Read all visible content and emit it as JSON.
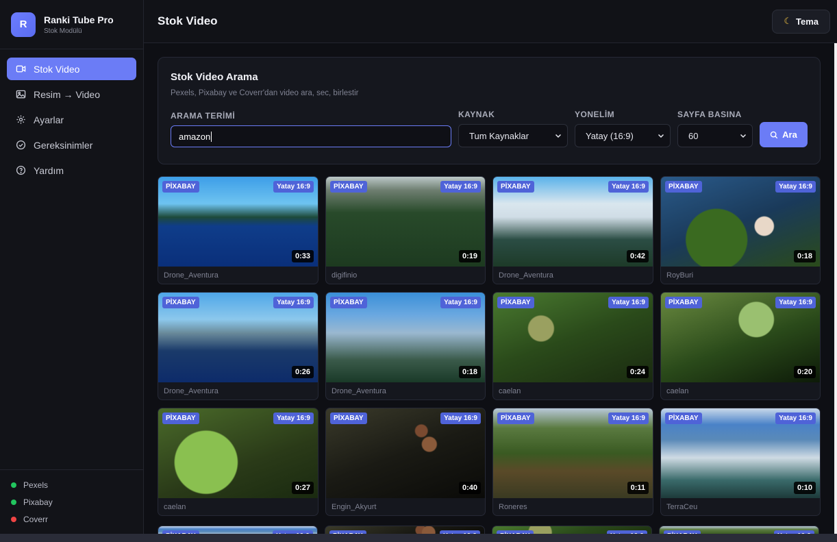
{
  "brand": {
    "logo_letter": "R",
    "title": "Ranki Tube Pro",
    "subtitle": "Stok Modülü"
  },
  "nav": [
    {
      "label": "Stok Video",
      "icon": "video-icon",
      "active": true
    },
    {
      "label": "Resim → Video",
      "icon": "image-icon",
      "active": false
    },
    {
      "label": "Ayarlar",
      "icon": "gear-icon",
      "active": false
    },
    {
      "label": "Gereksinimler",
      "icon": "check-circle-icon",
      "active": false
    },
    {
      "label": "Yardım",
      "icon": "help-icon",
      "active": false
    }
  ],
  "status": [
    {
      "label": "Pexels",
      "color": "#22c55e"
    },
    {
      "label": "Pixabay",
      "color": "#22c55e"
    },
    {
      "label": "Coverr",
      "color": "#ef4444"
    }
  ],
  "header": {
    "title": "Stok Video",
    "theme_label": "Tema",
    "theme_icon": "moon-icon"
  },
  "search": {
    "title": "Stok Video Arama",
    "subtitle": "Pexels, Pixabay ve Coverr'dan video ara, sec, birlestir",
    "term_label": "ARAMA TERİMİ",
    "term_value": "amazon",
    "source_label": "KAYNAK",
    "source_value": "Tum Kaynaklar",
    "orientation_label": "YONELİM",
    "orientation_value": "Yatay (16:9)",
    "per_page_label": "SAYFA BASINA",
    "per_page_value": "60",
    "button_label": "Ara"
  },
  "videos": [
    {
      "source": "PİXABAY",
      "orientation": "Yatay 16:9",
      "duration": "0:33",
      "author": "Drone_Aventura",
      "thumb": "t-lake1"
    },
    {
      "source": "PİXABAY",
      "orientation": "Yatay 16:9",
      "duration": "0:19",
      "author": "digifinio",
      "thumb": "t-forest1"
    },
    {
      "source": "PİXABAY",
      "orientation": "Yatay 16:9",
      "duration": "0:42",
      "author": "Drone_Aventura",
      "thumb": "t-cloud1"
    },
    {
      "source": "PİXABAY",
      "orientation": "Yatay 16:9",
      "duration": "0:18",
      "author": "RoyBuri",
      "thumb": "t-fish"
    },
    {
      "source": "PİXABAY",
      "orientation": "Yatay 16:9",
      "duration": "0:26",
      "author": "Drone_Aventura",
      "thumb": "t-lake2"
    },
    {
      "source": "PİXABAY",
      "orientation": "Yatay 16:9",
      "duration": "0:18",
      "author": "Drone_Aventura",
      "thumb": "t-mist"
    },
    {
      "source": "PİXABAY",
      "orientation": "Yatay 16:9",
      "duration": "0:24",
      "author": "caelan",
      "thumb": "t-jungle1"
    },
    {
      "source": "PİXABAY",
      "orientation": "Yatay 16:9",
      "duration": "0:20",
      "author": "caelan",
      "thumb": "t-fern"
    },
    {
      "source": "PİXABAY",
      "orientation": "Yatay 16:9",
      "duration": "0:27",
      "author": "caelan",
      "thumb": "t-leaf"
    },
    {
      "source": "PİXABAY",
      "orientation": "Yatay 16:9",
      "duration": "0:40",
      "author": "Engin_Akyurt",
      "thumb": "t-piranha"
    },
    {
      "source": "PİXABAY",
      "orientation": "Yatay 16:9",
      "duration": "0:11",
      "author": "Roneres",
      "thumb": "t-hut"
    },
    {
      "source": "PİXABAY",
      "orientation": "Yatay 16:9",
      "duration": "0:10",
      "author": "TerraCeu",
      "thumb": "t-clouds"
    }
  ],
  "partial_row": [
    {
      "thumb": "t-clouds"
    },
    {
      "thumb": "t-piranha"
    },
    {
      "thumb": "t-jungle1"
    },
    {
      "thumb": "t-hut"
    }
  ],
  "colors": {
    "accent": "#6b7cf6",
    "badge": "#4f63d8",
    "online": "#22c55e",
    "offline": "#ef4444"
  }
}
